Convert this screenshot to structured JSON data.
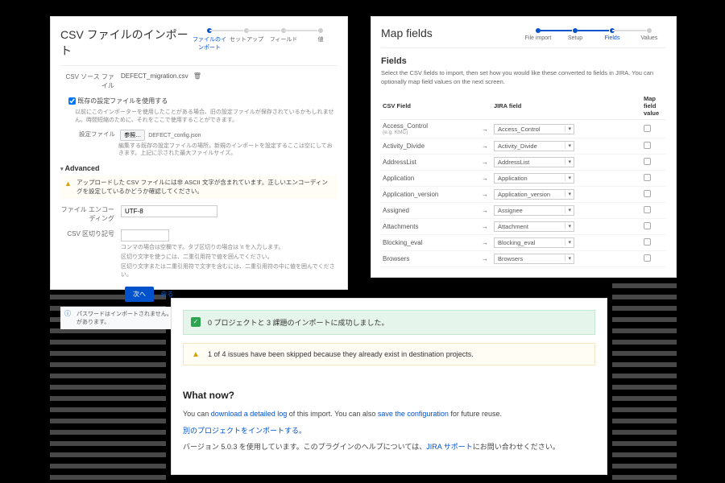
{
  "left": {
    "title": "CSV ファイルのインポート",
    "stepper": [
      "ファイルのインポート",
      "セットアップ",
      "フィールド",
      "値"
    ],
    "source_label": "CSV ソース ファイル",
    "source_file": "DEFECT_migration.csv",
    "use_existing": "既存の設定ファイルを使用する",
    "use_existing_help": "以前にこのインポーターを使用したことがある場合、旧の設定ファイルが保存されているかもしれません。時間短縮のために、それをここで使用することができます。",
    "config_label": "設定ファイル",
    "choose_btn": "参照…",
    "config_file": "DEFECT_config.json",
    "config_help": "編集する既存の設定ファイルの場所。新規のインポートを設定するここは空にしておきます。上記に示された最大ファイルサイズ。",
    "advanced": "Advanced",
    "ascii_warn": "アップロードした CSV ファイルには非 ASCII 文字が含まれています。正しいエンコーディングを設定しているかどうか確認してください。",
    "encoding_label": "ファイル エンコーディング",
    "encoding_value": "UTF-8",
    "delimiter_label": "CSV 区切り記号",
    "delimiter_value": "",
    "delimiter_help1": "コンマの場合は空欄です。タブ区切りの場合は \\t を入力します。",
    "delimiter_help2": "区切り文字を使うには、二重引用符で値を囲んでください。",
    "delimiter_help3": "区切り文字または二重引用符で文字を含むには、二重引用符の中に値を囲んでください。",
    "next": "次へ",
    "back": "戻る",
    "info_msg": "パスワードはインポートされません。ユーザーは初回のログイン時に新規パスワードを作成する必要があります。"
  },
  "right": {
    "title": "Map fields",
    "stepper": [
      "File import",
      "Setup",
      "Fields",
      "Values"
    ],
    "subtitle": "Fields",
    "desc": "Select the CSV fields to import, then set how you would like these converted to fields in JIRA. You can optionally map field values on the next screen.",
    "col_csv": "CSV Field",
    "col_jira": "JIRA field",
    "col_map": "Map field value",
    "rows": [
      {
        "csv": "Access_Control",
        "eg": "(e.g. KMC)",
        "jira": "Access_Control"
      },
      {
        "csv": "Activity_Divide",
        "jira": "Activity_Divide"
      },
      {
        "csv": "AddressList",
        "jira": "AddressList"
      },
      {
        "csv": "Application",
        "jira": "Application"
      },
      {
        "csv": "Application_version",
        "jira": "Application_version"
      },
      {
        "csv": "Assigned",
        "jira": "Assignee"
      },
      {
        "csv": "Attachments",
        "jira": "Attachment"
      },
      {
        "csv": "Blocking_eval",
        "jira": "Blocking_eval"
      },
      {
        "csv": "Browsers",
        "jira": "Browsers"
      }
    ]
  },
  "bottom": {
    "success": "0 プロジェクトと 3 課題のインポートに成功しました。",
    "warning": "1 of 4 issues have been skipped because they already exist in destination projects.",
    "what_now": "What now?",
    "line1_a": "You can ",
    "line1_link1": "download a detailed log",
    "line1_b": " of this import. You can also ",
    "line1_link2": "save the configuration",
    "line1_c": " for future reuse.",
    "line2": "別のプロジェクトをインポートする。",
    "line3_a": "バージョン 5.0.3 を使用しています。このプラグインのヘルプについては、",
    "line3_link": "JIRA サポート",
    "line3_b": "にお問い合わせください。"
  }
}
